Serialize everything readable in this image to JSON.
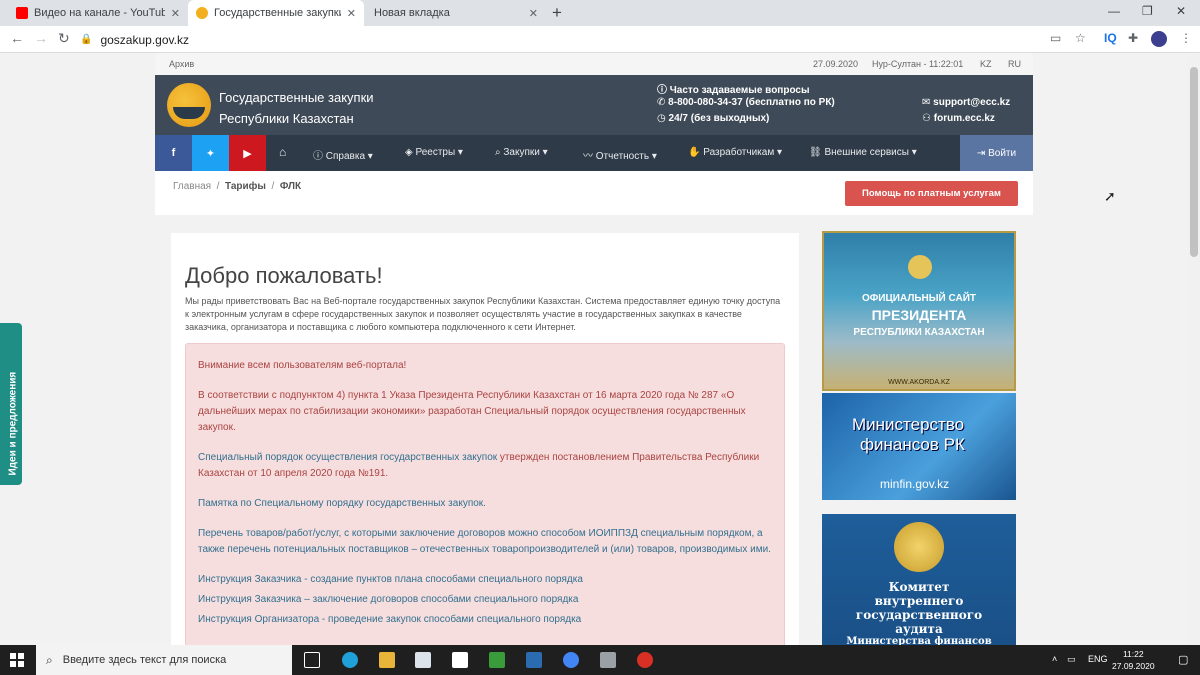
{
  "browser": {
    "tabs": [
      {
        "title": "Видео на канале - YouTube Stud",
        "favicon_color": "#ff0000",
        "close": "✕"
      },
      {
        "title": "Государственные закупки Респ",
        "favicon_color": "#f2b01e",
        "close": "✕"
      },
      {
        "title": "Новая вкладка",
        "close": "✕"
      }
    ],
    "new_tab": "+",
    "url": "goszakup.gov.kz",
    "ext_iq": "IQ"
  },
  "site": {
    "top": {
      "archive": "Архив",
      "date": "27.09.2020",
      "city_time": "Нур-Султан - 11:22:01",
      "lang_kz": "KZ",
      "lang_ru": "RU"
    },
    "header": {
      "title1": "Государственные закупки",
      "title2": "Республики Казахстан",
      "faq": "Часто задаваемые вопросы",
      "phone": "8-800-080-34-37 (бесплатно по РК)",
      "hours": "24/7 (без выходных)",
      "email": "support@ecc.kz",
      "forum": "forum.ecc.kz"
    },
    "nav": {
      "items": [
        "Справка",
        "Реестры",
        "Закупки",
        "Отчетность",
        "Разработчикам",
        "Внешние сервисы"
      ],
      "login": "Войти"
    },
    "breadcrumb": {
      "home": "Главная",
      "tariffs": "Тарифы",
      "current": "ФЛК"
    },
    "help_button": "Помощь по платным услугам",
    "content": {
      "title": "Добро пожаловать!",
      "intro": "Мы рады приветствовать Вас на Веб-портале государственных закупок Республики Казахстан. Система предоставляет единую точку доступа к электронным услугам в сфере государственных закупок и позволяет осуществлять участие в государственных закупках в качестве заказчика, организатора и поставщика с любого компьютера подключенного к сети Интернет.",
      "alert_title": "Внимание всем пользователям веб-портала!",
      "alert_p1": "В соответствии с подпунктом 4) пункта 1 Указа Президента Республики Казахстан от 16 марта 2020 года № 287 «О дальнейших мерах по стабилизации экономики» разработан Специальный порядок осуществления государственных закупок.",
      "alert_p2_link": "Специальный порядок осуществления государственных закупок",
      "alert_p2_rest": " утвержден постановлением Правительства Республики Казахстан от 10 апреля 2020 года №191.",
      "alert_p3": "Памятка по Специальному порядку государственных закупок.",
      "alert_p4": "Перечень товаров/работ/услуг, с которыми заключение договоров можно способом ИОИППЗД специальным порядком, а также перечень потенциальных поставщиков – отечественных товаропроизводителей и (или) товаров, производимых ими.",
      "instructions": [
        "Инструкция Заказчика - создание пунктов плана способами специального порядка",
        "Инструкция Заказчика – заключение договоров способами специального порядка",
        "Инструкция Организатора - проведение закупок способами специального порядка"
      ]
    },
    "banners": {
      "president": {
        "line1": "ОФИЦИАЛЬНЫЙ САЙТ",
        "line2": "ПРЕЗИДЕНТА",
        "line3": "РЕСПУБЛИКИ КАЗАХСТАН",
        "url": "WWW.AKORDA.KZ"
      },
      "minfin": {
        "line1": "Министерство",
        "line2": "финансов РК",
        "url": "minfin.gov.kz"
      },
      "audit": {
        "line1": "Комитет",
        "line2": "внутреннего",
        "line3": "государственного",
        "line4": "аудита",
        "line5": "Министерства финансов"
      }
    },
    "ideas_tab": "Идеи и предложения"
  },
  "taskbar": {
    "search_placeholder": "Введите здесь текст для поиска",
    "lang": "ENG",
    "time": "11:22",
    "date": "27.09.2020"
  }
}
